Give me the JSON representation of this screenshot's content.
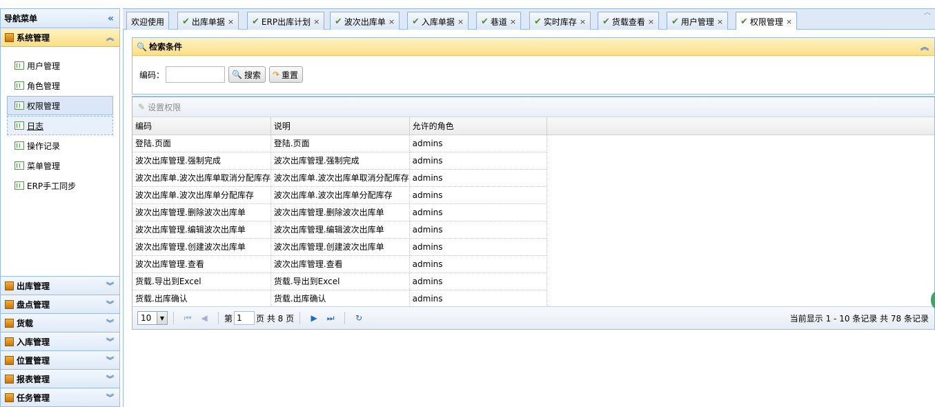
{
  "nav": {
    "title": "导航菜单",
    "collapse_icon": "double-chevron-left-icon",
    "active_group": "系统管理",
    "items": [
      {
        "label": "用户管理",
        "state": "normal"
      },
      {
        "label": "角色管理",
        "state": "normal"
      },
      {
        "label": "权限管理",
        "state": "selected"
      },
      {
        "label": "日志",
        "state": "hovered"
      },
      {
        "label": "操作记录",
        "state": "normal"
      },
      {
        "label": "菜单管理",
        "state": "normal"
      },
      {
        "label": "ERP手工同步",
        "state": "normal"
      }
    ],
    "groups": [
      "出库管理",
      "盘点管理",
      "货载",
      "入库管理",
      "位置管理",
      "报表管理",
      "任务管理"
    ]
  },
  "tabs": [
    {
      "label": "欢迎使用",
      "closable": false,
      "active": false
    },
    {
      "label": "出库单据",
      "closable": true,
      "active": false
    },
    {
      "label": "ERP出库计划",
      "closable": true,
      "active": false
    },
    {
      "label": "波次出库单",
      "closable": true,
      "active": false
    },
    {
      "label": "入库单据",
      "closable": true,
      "active": false
    },
    {
      "label": "巷道",
      "closable": true,
      "active": false
    },
    {
      "label": "实时库存",
      "closable": true,
      "active": false
    },
    {
      "label": "货载查看",
      "closable": true,
      "active": false
    },
    {
      "label": "用户管理",
      "closable": true,
      "active": false
    },
    {
      "label": "权限管理",
      "closable": true,
      "active": true
    }
  ],
  "search": {
    "title": "检索条件",
    "field_label": "编码：",
    "field_value": "",
    "search_button": "搜索",
    "reset_button": "重置"
  },
  "grid": {
    "toolbar_button": "设置权限",
    "columns": [
      "编码",
      "说明",
      "允许的角色"
    ],
    "rows": [
      [
        "登陆.页面",
        "登陆.页面",
        "admins"
      ],
      [
        "波次出库管理.强制完成",
        "波次出库管理.强制完成",
        "admins"
      ],
      [
        "波次出库单.波次出库单取消分配库存",
        "波次出库单.波次出库单取消分配库存",
        "admins"
      ],
      [
        "波次出库单.波次出库单分配库存",
        "波次出库单.波次出库单分配库存",
        "admins"
      ],
      [
        "波次出库管理.删除波次出库单",
        "波次出库管理.删除波次出库单",
        "admins"
      ],
      [
        "波次出库管理.编辑波次出库单",
        "波次出库管理.编辑波次出库单",
        "admins"
      ],
      [
        "波次出库管理.创建波次出库单",
        "波次出库管理.创建波次出库单",
        "admins"
      ],
      [
        "波次出库管理.查看",
        "波次出库管理.查看",
        "admins"
      ],
      [
        "货载.导出到Excel",
        "货载.导出到Excel",
        "admins"
      ],
      [
        "货载.出库确认",
        "货载.出库确认",
        "admins"
      ]
    ]
  },
  "pager": {
    "page_size": "10",
    "page_prefix": "第",
    "page_value": "1",
    "page_suffix": "页 共 8 页",
    "summary": "当前显示 1 - 10 条记录 共 78 条记录"
  },
  "colors": {
    "border": "#99bbe8",
    "header_yellow": "#fbdf86",
    "accent_blue": "#1d6bc9",
    "check_green": "#4a8f2a"
  }
}
